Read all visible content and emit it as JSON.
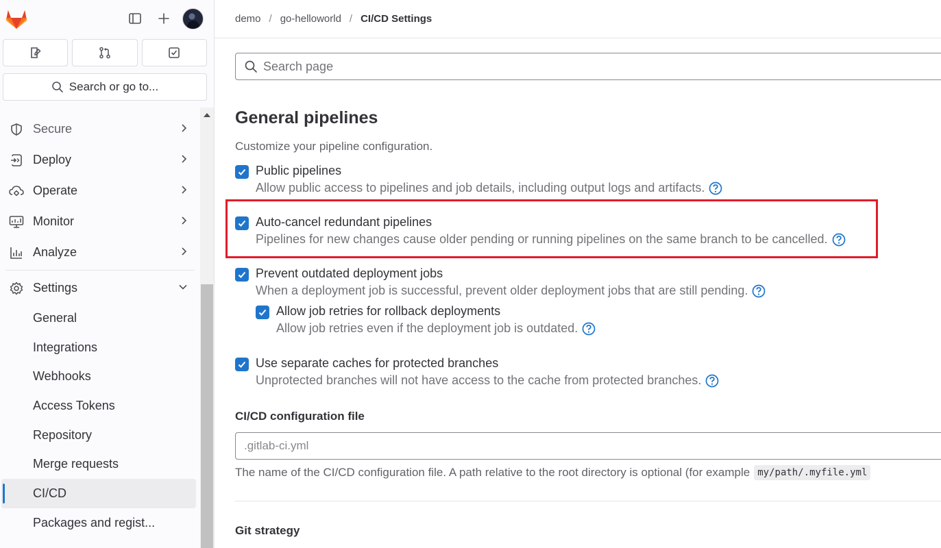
{
  "sidebar": {
    "search_label": "Search or go to...",
    "nav": [
      {
        "label": "Secure",
        "icon": "shield-icon"
      },
      {
        "label": "Deploy",
        "icon": "deploy-icon"
      },
      {
        "label": "Operate",
        "icon": "cloud-gear-icon"
      },
      {
        "label": "Monitor",
        "icon": "monitor-icon"
      },
      {
        "label": "Analyze",
        "icon": "chart-icon"
      }
    ],
    "settings": {
      "label": "Settings",
      "icon": "gear-icon",
      "items": [
        "General",
        "Integrations",
        "Webhooks",
        "Access Tokens",
        "Repository",
        "Merge requests",
        "CI/CD",
        "Packages and regist..."
      ],
      "active": "CI/CD"
    }
  },
  "breadcrumb": {
    "items": [
      "demo",
      "go-helloworld"
    ],
    "current": "CI/CD Settings"
  },
  "page_search": {
    "placeholder": "Search page"
  },
  "section": {
    "title": "General pipelines",
    "description": "Customize your pipeline configuration."
  },
  "options": {
    "public_pipelines": {
      "label": "Public pipelines",
      "help": "Allow public access to pipelines and job details, including output logs and artifacts.",
      "checked": true
    },
    "auto_cancel": {
      "label": "Auto-cancel redundant pipelines",
      "help": "Pipelines for new changes cause older pending or running pipelines on the same branch to be cancelled.",
      "checked": true
    },
    "prevent_outdated": {
      "label": "Prevent outdated deployment jobs",
      "help": "When a deployment job is successful, prevent older deployment jobs that are still pending.",
      "checked": true
    },
    "allow_retries": {
      "label": "Allow job retries for rollback deployments",
      "help": "Allow job retries even if the deployment job is outdated.",
      "checked": true
    },
    "separate_caches": {
      "label": "Use separate caches for protected branches",
      "help": "Unprotected branches will not have access to the cache from protected branches.",
      "checked": true
    }
  },
  "ci_config": {
    "label": "CI/CD configuration file",
    "placeholder": ".gitlab-ci.yml",
    "help": "The name of the CI/CD configuration file. A path relative to the root directory is optional (for example",
    "example": "my/path/.myfile.yml"
  },
  "git_strategy": {
    "label": "Git strategy"
  },
  "colors": {
    "accent": "#1f75cb",
    "highlight": "#e11d2b",
    "logo": "#e24329"
  }
}
